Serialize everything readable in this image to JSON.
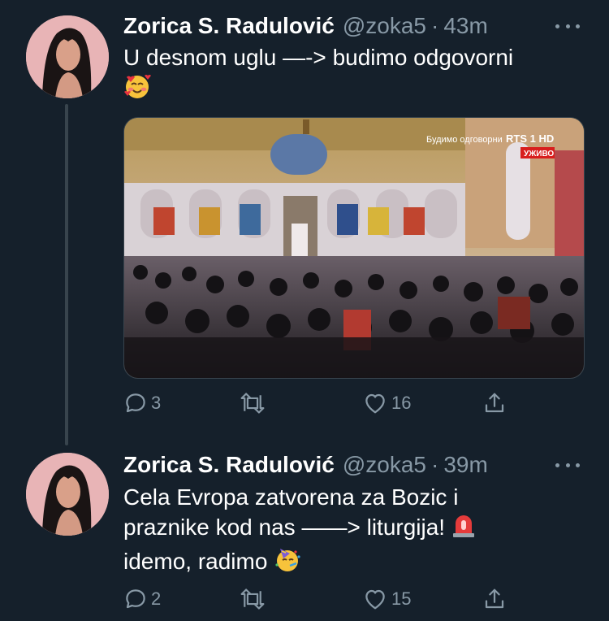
{
  "tweets": [
    {
      "name": "Zorica S. Radulović",
      "handle": "@zoka5",
      "separator": "·",
      "time": "43m",
      "text": "U desnom uglu —-> budimo odgovorni",
      "emoji": "smiling-face-with-hearts",
      "media": {
        "overlay_text": "Будимо одговорни",
        "channel": "RTS 1 HD",
        "live_badge": "УЖИВО"
      },
      "replies": "3",
      "retweets": "",
      "likes": "16"
    },
    {
      "name": "Zorica S. Radulović",
      "handle": "@zoka5",
      "separator": "·",
      "time": "39m",
      "text_line1": "Cela Evropa zatvorena za Bozic i",
      "text_line2": "praznike kod nas ——> liturgija!",
      "text_line3": "idemo, radimo",
      "emoji_siren": "rotating-light",
      "emoji_party": "partying-face",
      "replies": "2",
      "retweets": "",
      "likes": "15"
    }
  ],
  "colors": {
    "background": "#15202b",
    "secondary_text": "#8899a6",
    "thread_line": "#38444d"
  }
}
